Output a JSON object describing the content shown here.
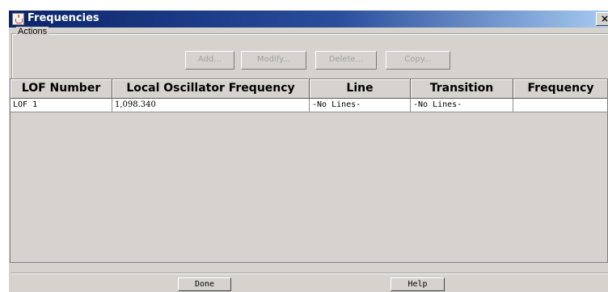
{
  "window": {
    "title": "Frequencies",
    "close_label": "×"
  },
  "actions": {
    "legend": "Actions",
    "buttons": {
      "add": "Add...",
      "modify": "Modify...",
      "delete": "Delete...",
      "copy": "Copy..."
    }
  },
  "table": {
    "columns": [
      "LOF Number",
      "Local Oscillator Frequency",
      "Line",
      "Transition",
      "Frequency"
    ],
    "rows": [
      [
        "LOF 1",
        "1,098.340",
        "-No Lines-",
        "-No Lines-",
        ""
      ]
    ]
  },
  "footer": {
    "done": "Done",
    "help": "Help"
  }
}
